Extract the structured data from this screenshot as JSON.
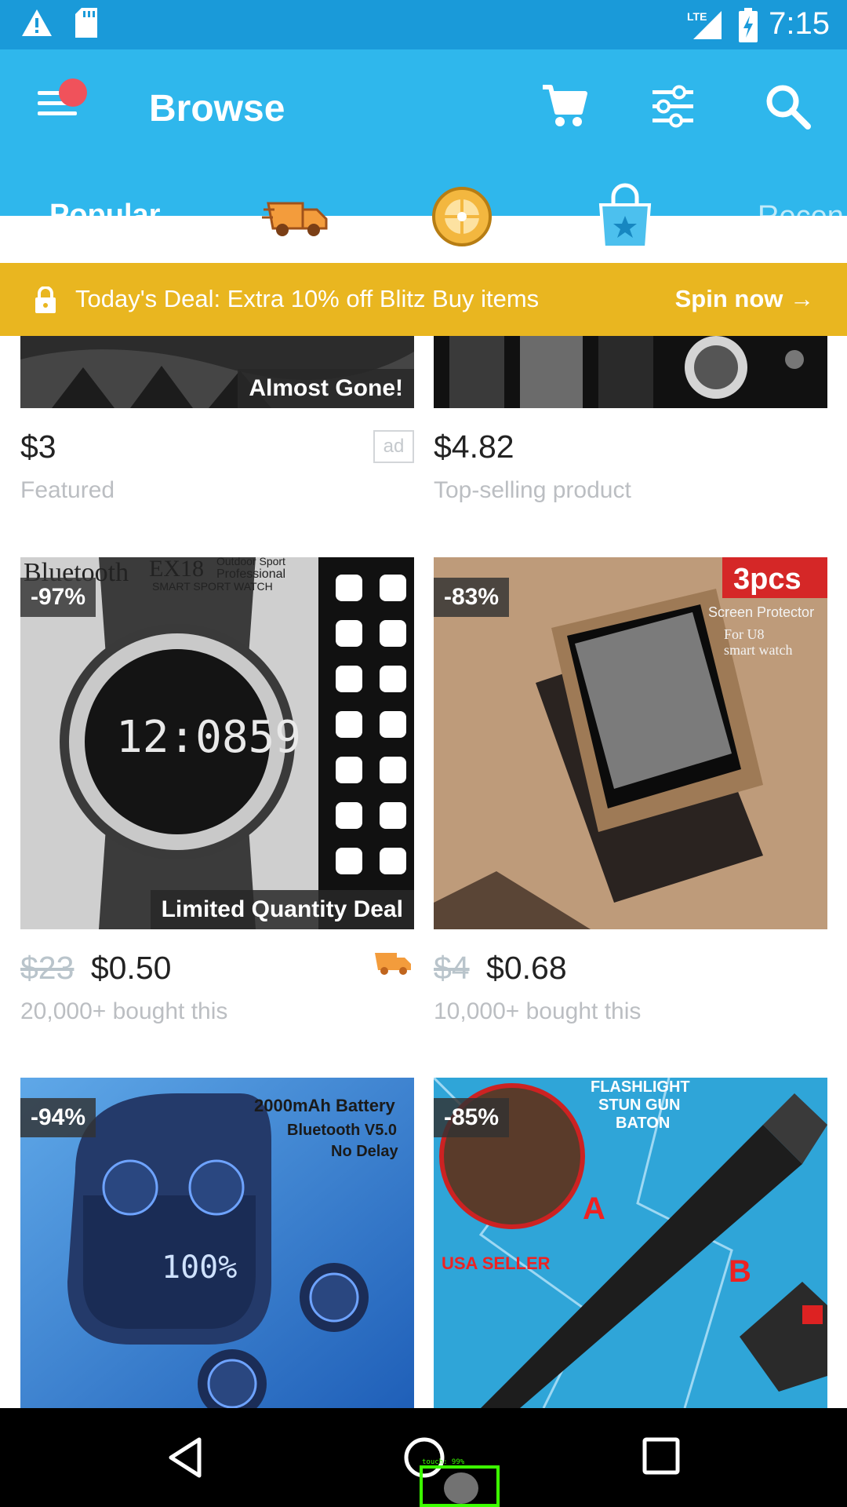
{
  "status_bar": {
    "time": "7:15",
    "network": "LTE",
    "icons": [
      "warning-icon",
      "sd-card-icon",
      "signal-icon",
      "battery-charging-icon"
    ]
  },
  "app_bar": {
    "title": "Browse",
    "icons": [
      "menu-icon",
      "cart-icon",
      "filter-icon",
      "search-icon"
    ]
  },
  "tabs": {
    "items": [
      "Popular",
      "truck-icon",
      "wheel-icon",
      "shopping-bag-icon",
      "Recen"
    ],
    "active": "Popular"
  },
  "deal_banner": {
    "text": "Today's Deal: Extra 10% off Blitz Buy items",
    "cta": "Spin now →"
  },
  "products": [
    {
      "badge": "Almost Gone!",
      "price": "$3",
      "subtitle": "Featured",
      "ad": "ad"
    },
    {
      "price": "$4.82",
      "subtitle": "Top-selling product"
    },
    {
      "discount": "-97%",
      "badge": "Limited Quantity Deal",
      "image_title": "Bluetooth",
      "image_model": "EX18",
      "image_caption_1": "Outdoor Sport",
      "image_caption_2": "Professional",
      "image_caption_3": "SMART SPORT WATCH",
      "image_time": "12:0859",
      "old_price": "$23",
      "price": "$0.50",
      "subtitle": "20,000+ bought this",
      "shipping_icon": "truck-icon"
    },
    {
      "discount": "-83%",
      "image_tag": "3pcs",
      "image_caption_1": "Screen Protector",
      "image_caption_2": "For U8",
      "image_caption_3": "smart watch",
      "old_price": "$4",
      "price": "$0.68",
      "subtitle": "10,000+ bought this"
    },
    {
      "discount": "-94%",
      "image_caption_1": "2000mAh Battery",
      "image_caption_2": "Bluetooth V5.0",
      "image_caption_3": "No Delay",
      "image_display": "100%"
    },
    {
      "discount": "-85%",
      "image_caption_1": "FLASHLIGHT",
      "image_caption_2": "STUN GUN",
      "image_caption_3": "BATON",
      "image_tag": "USA SELLER",
      "label_a": "A",
      "label_b": "B"
    }
  ],
  "nav_bar": {
    "buttons": [
      "back-icon",
      "home-icon",
      "recents-icon"
    ],
    "touch_overlay": "touch: 99%"
  },
  "colors": {
    "status_bar": "#1a9ad9",
    "app_bar": "#2fb7ec",
    "deal_banner": "#e9b620",
    "notification_dot": "#f0525b",
    "shipping_orange": "#f39c3c"
  }
}
